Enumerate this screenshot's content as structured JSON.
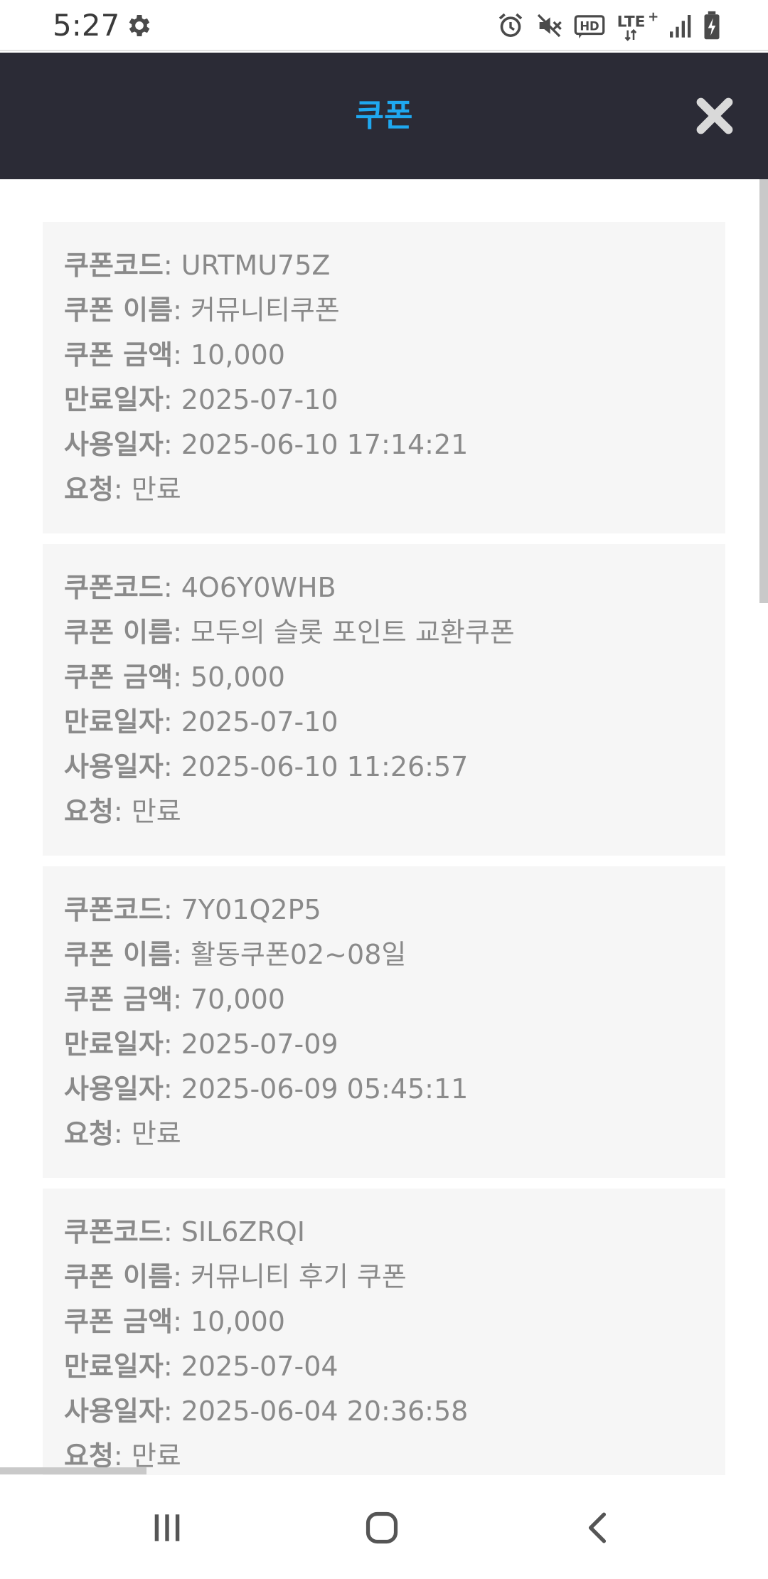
{
  "status_bar": {
    "time": "5:27",
    "icons": [
      "gear-icon",
      "alarm-icon",
      "mute-icon",
      "hd-icon",
      "lte-plus-icon",
      "signal-icon",
      "battery-charging-icon"
    ],
    "hd_text": "HD",
    "lte_text": "LTE",
    "lte_plus": "+"
  },
  "header": {
    "title": "쿠폰",
    "close_icon": "close-icon",
    "title_color": "#1fa8f0",
    "background": "#2b2b36"
  },
  "labels": {
    "code": "쿠폰코드",
    "name": "쿠폰 이름",
    "amount": "쿠폰 금액",
    "expiry": "만료일자",
    "used": "사용일자",
    "status": "요청",
    "separator": ":"
  },
  "coupons": [
    {
      "code": "URTMU75Z",
      "name": "커뮤니티쿠폰",
      "amount": "10,000",
      "expiry": "2025-07-10",
      "used": "2025-06-10 17:14:21",
      "status": "만료"
    },
    {
      "code": "4O6Y0WHB",
      "name": "모두의 슬롯 포인트 교환쿠폰",
      "amount": "50,000",
      "expiry": "2025-07-10",
      "used": "2025-06-10 11:26:57",
      "status": "만료"
    },
    {
      "code": "7Y01Q2P5",
      "name": "활동쿠폰02~08일",
      "amount": "70,000",
      "expiry": "2025-07-09",
      "used": "2025-06-09 05:45:11",
      "status": "만료"
    },
    {
      "code": "SIL6ZRQI",
      "name": "커뮤니티 후기 쿠폰",
      "amount": "10,000",
      "expiry": "2025-07-04",
      "used": "2025-06-04 20:36:58",
      "status": "만료"
    }
  ],
  "nav_bar": {
    "icons": [
      "recent-apps-icon",
      "home-icon",
      "back-icon"
    ]
  }
}
